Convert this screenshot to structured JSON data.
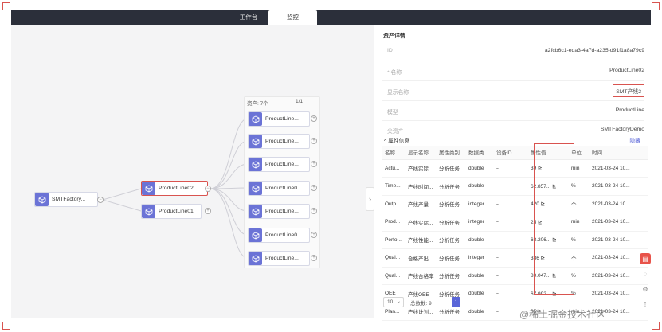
{
  "tabs": [
    {
      "label": "工作台",
      "active": false
    },
    {
      "label": "监控",
      "active": true
    }
  ],
  "tree": {
    "root": {
      "label": "SMTFactory..."
    },
    "level1": [
      {
        "label": "ProductLine02",
        "selected": true
      },
      {
        "label": "ProductLine01",
        "selected": false
      }
    ],
    "children_header": {
      "title": "资产: 7个",
      "page": "1/1"
    },
    "children": [
      {
        "label": "ProductLine..."
      },
      {
        "label": "ProductLine..."
      },
      {
        "label": "ProductLine..."
      },
      {
        "label": "ProductLine0..."
      },
      {
        "label": "ProductLine..."
      },
      {
        "label": "ProductLine0..."
      },
      {
        "label": "ProductLine..."
      }
    ]
  },
  "detail": {
    "title": "资产详情",
    "props": [
      {
        "key": "ID",
        "value": "a2fcb6c1-eda3-4a7d-a235-d91f1a8a79c9",
        "boxed": false
      },
      {
        "key": "* 名称",
        "value": "ProductLine02",
        "boxed": false
      },
      {
        "key": "显示名称",
        "value": "SMT产线2",
        "boxed": true
      },
      {
        "key": "模型",
        "value": "ProductLine",
        "boxed": false
      },
      {
        "key": "父资产",
        "value": "SMTFactoryDemo",
        "boxed": false
      }
    ],
    "attr_section": {
      "title": "^ 属性信息",
      "link": "隐藏"
    },
    "attr_columns": [
      "名称",
      "显示名称",
      "属性类别",
      "数据类...",
      "设备ID",
      "属性值",
      "单位",
      "时间"
    ],
    "attr_rows": [
      [
        "Actu...",
        "产线实际...",
        "分析任务",
        "double",
        "--",
        "39 ⊵",
        "min",
        "2021-03-24 10..."
      ],
      [
        "Time...",
        "产线时间...",
        "分析任务",
        "double",
        "--",
        "62.857... ⊵",
        "%",
        "2021-03-24 10..."
      ],
      [
        "Outp...",
        "产线产量",
        "分析任务",
        "integer",
        "--",
        "420 ⊵",
        "个",
        "2021-03-24 10..."
      ],
      [
        "Prod...",
        "产线实际...",
        "分析任务",
        "integer",
        "--",
        "25 ⊵",
        "min",
        "2021-03-24 10..."
      ],
      [
        "Perfo...",
        "产线性能...",
        "分析任务",
        "double",
        "--",
        "68.206... ⊵",
        "%",
        "2021-03-24 10..."
      ],
      [
        "Qual...",
        "合格产出...",
        "分析任务",
        "integer",
        "--",
        "386 ⊵",
        "个",
        "2021-03-24 10..."
      ],
      [
        "Qual...",
        "产线合格率",
        "分析任务",
        "double",
        "--",
        "89.047... ⊵",
        "%",
        "2021-03-24 10..."
      ],
      [
        "OEE",
        "产线OEE",
        "分析任务",
        "double",
        "--",
        "67.992... ⊵",
        "%",
        "2021-03-24 10..."
      ],
      [
        "Plan...",
        "产线计划...",
        "分析任务",
        "double",
        "--",
        "35 ⊵",
        "min",
        "2021-03-24 10..."
      ]
    ],
    "pager": {
      "page_size": "10",
      "total": "总数数: 9",
      "current": "1"
    }
  },
  "watermark": "@稀土掘金技术社区",
  "colors": {
    "accent": "#5a66d8",
    "highlight": "#d9534f",
    "topbar": "#2b2f3a",
    "node_icon": "#6b73d6"
  }
}
